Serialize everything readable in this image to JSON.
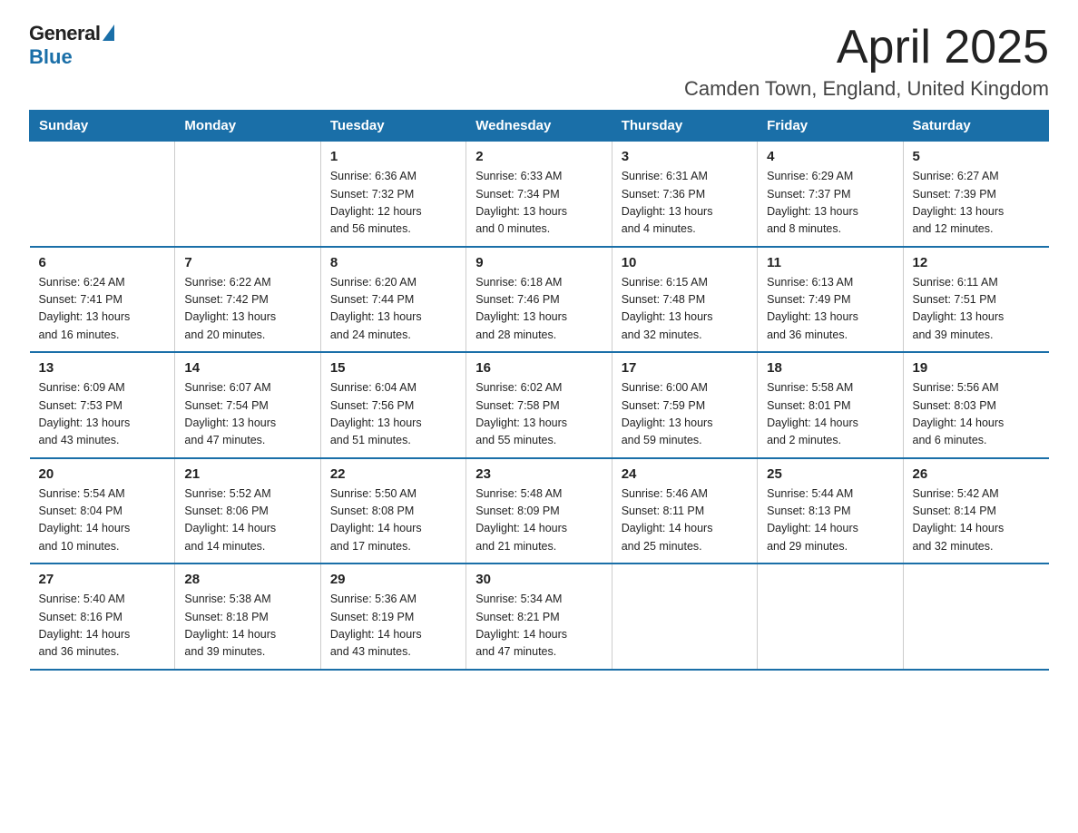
{
  "header": {
    "logo_general": "General",
    "logo_blue": "Blue",
    "month_title": "April 2025",
    "location": "Camden Town, England, United Kingdom"
  },
  "days_of_week": [
    "Sunday",
    "Monday",
    "Tuesday",
    "Wednesday",
    "Thursday",
    "Friday",
    "Saturday"
  ],
  "weeks": [
    [
      {
        "day": "",
        "info": ""
      },
      {
        "day": "",
        "info": ""
      },
      {
        "day": "1",
        "info": "Sunrise: 6:36 AM\nSunset: 7:32 PM\nDaylight: 12 hours\nand 56 minutes."
      },
      {
        "day": "2",
        "info": "Sunrise: 6:33 AM\nSunset: 7:34 PM\nDaylight: 13 hours\nand 0 minutes."
      },
      {
        "day": "3",
        "info": "Sunrise: 6:31 AM\nSunset: 7:36 PM\nDaylight: 13 hours\nand 4 minutes."
      },
      {
        "day": "4",
        "info": "Sunrise: 6:29 AM\nSunset: 7:37 PM\nDaylight: 13 hours\nand 8 minutes."
      },
      {
        "day": "5",
        "info": "Sunrise: 6:27 AM\nSunset: 7:39 PM\nDaylight: 13 hours\nand 12 minutes."
      }
    ],
    [
      {
        "day": "6",
        "info": "Sunrise: 6:24 AM\nSunset: 7:41 PM\nDaylight: 13 hours\nand 16 minutes."
      },
      {
        "day": "7",
        "info": "Sunrise: 6:22 AM\nSunset: 7:42 PM\nDaylight: 13 hours\nand 20 minutes."
      },
      {
        "day": "8",
        "info": "Sunrise: 6:20 AM\nSunset: 7:44 PM\nDaylight: 13 hours\nand 24 minutes."
      },
      {
        "day": "9",
        "info": "Sunrise: 6:18 AM\nSunset: 7:46 PM\nDaylight: 13 hours\nand 28 minutes."
      },
      {
        "day": "10",
        "info": "Sunrise: 6:15 AM\nSunset: 7:48 PM\nDaylight: 13 hours\nand 32 minutes."
      },
      {
        "day": "11",
        "info": "Sunrise: 6:13 AM\nSunset: 7:49 PM\nDaylight: 13 hours\nand 36 minutes."
      },
      {
        "day": "12",
        "info": "Sunrise: 6:11 AM\nSunset: 7:51 PM\nDaylight: 13 hours\nand 39 minutes."
      }
    ],
    [
      {
        "day": "13",
        "info": "Sunrise: 6:09 AM\nSunset: 7:53 PM\nDaylight: 13 hours\nand 43 minutes."
      },
      {
        "day": "14",
        "info": "Sunrise: 6:07 AM\nSunset: 7:54 PM\nDaylight: 13 hours\nand 47 minutes."
      },
      {
        "day": "15",
        "info": "Sunrise: 6:04 AM\nSunset: 7:56 PM\nDaylight: 13 hours\nand 51 minutes."
      },
      {
        "day": "16",
        "info": "Sunrise: 6:02 AM\nSunset: 7:58 PM\nDaylight: 13 hours\nand 55 minutes."
      },
      {
        "day": "17",
        "info": "Sunrise: 6:00 AM\nSunset: 7:59 PM\nDaylight: 13 hours\nand 59 minutes."
      },
      {
        "day": "18",
        "info": "Sunrise: 5:58 AM\nSunset: 8:01 PM\nDaylight: 14 hours\nand 2 minutes."
      },
      {
        "day": "19",
        "info": "Sunrise: 5:56 AM\nSunset: 8:03 PM\nDaylight: 14 hours\nand 6 minutes."
      }
    ],
    [
      {
        "day": "20",
        "info": "Sunrise: 5:54 AM\nSunset: 8:04 PM\nDaylight: 14 hours\nand 10 minutes."
      },
      {
        "day": "21",
        "info": "Sunrise: 5:52 AM\nSunset: 8:06 PM\nDaylight: 14 hours\nand 14 minutes."
      },
      {
        "day": "22",
        "info": "Sunrise: 5:50 AM\nSunset: 8:08 PM\nDaylight: 14 hours\nand 17 minutes."
      },
      {
        "day": "23",
        "info": "Sunrise: 5:48 AM\nSunset: 8:09 PM\nDaylight: 14 hours\nand 21 minutes."
      },
      {
        "day": "24",
        "info": "Sunrise: 5:46 AM\nSunset: 8:11 PM\nDaylight: 14 hours\nand 25 minutes."
      },
      {
        "day": "25",
        "info": "Sunrise: 5:44 AM\nSunset: 8:13 PM\nDaylight: 14 hours\nand 29 minutes."
      },
      {
        "day": "26",
        "info": "Sunrise: 5:42 AM\nSunset: 8:14 PM\nDaylight: 14 hours\nand 32 minutes."
      }
    ],
    [
      {
        "day": "27",
        "info": "Sunrise: 5:40 AM\nSunset: 8:16 PM\nDaylight: 14 hours\nand 36 minutes."
      },
      {
        "day": "28",
        "info": "Sunrise: 5:38 AM\nSunset: 8:18 PM\nDaylight: 14 hours\nand 39 minutes."
      },
      {
        "day": "29",
        "info": "Sunrise: 5:36 AM\nSunset: 8:19 PM\nDaylight: 14 hours\nand 43 minutes."
      },
      {
        "day": "30",
        "info": "Sunrise: 5:34 AM\nSunset: 8:21 PM\nDaylight: 14 hours\nand 47 minutes."
      },
      {
        "day": "",
        "info": ""
      },
      {
        "day": "",
        "info": ""
      },
      {
        "day": "",
        "info": ""
      }
    ]
  ]
}
